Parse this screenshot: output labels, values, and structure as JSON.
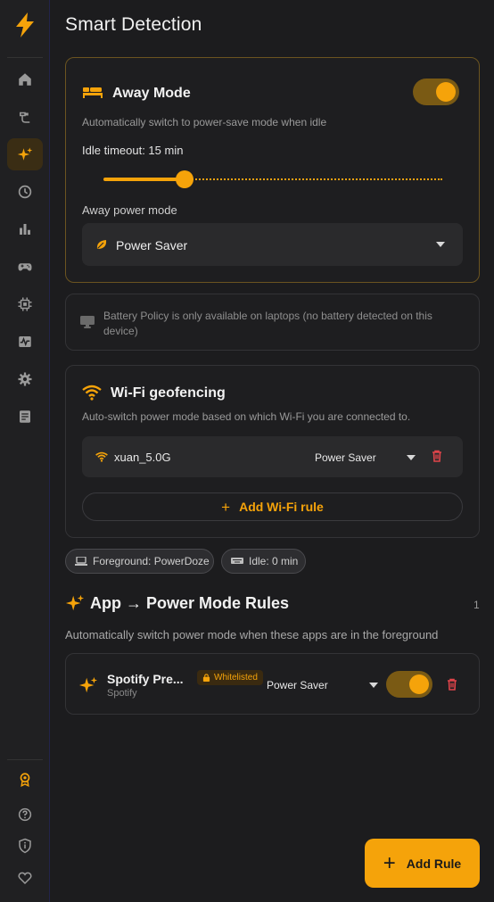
{
  "sidebar": {
    "logo_icon": "lightning-bolt-icon",
    "top_items": [
      {
        "icon": "home-icon"
      },
      {
        "icon": "plug-icon"
      },
      {
        "icon": "sparkles-icon",
        "active": true
      },
      {
        "icon": "clock-icon"
      },
      {
        "icon": "bar-chart-icon"
      },
      {
        "icon": "gamepad-icon"
      },
      {
        "icon": "cpu-icon"
      },
      {
        "icon": "activity-monitor-icon"
      },
      {
        "icon": "gear-icon"
      },
      {
        "icon": "document-icon"
      }
    ],
    "bottom_items": [
      {
        "icon": "award-icon"
      },
      {
        "icon": "help-icon"
      },
      {
        "icon": "shield-info-icon"
      },
      {
        "icon": "heart-icon"
      }
    ]
  },
  "page": {
    "title": "Smart Detection"
  },
  "away_mode": {
    "title": "Away Mode",
    "description": "Automatically switch to power-save mode when idle",
    "enabled": true,
    "idle_timeout_label": "Idle timeout: 15 min",
    "idle_timeout_fraction": 0.24,
    "power_mode_label": "Away power mode",
    "power_mode_value": "Power Saver"
  },
  "battery_notice": {
    "text": "Battery Policy is only available on laptops (no battery detected on this device)"
  },
  "wifi": {
    "title": "Wi-Fi geofencing",
    "description": "Auto-switch power mode based on which Wi-Fi you are connected to.",
    "rules": [
      {
        "ssid": "xuan_5.0G",
        "mode": "Power Saver"
      }
    ],
    "add_label": "Add Wi-Fi rule"
  },
  "status_chips": {
    "foreground": "Foreground: PowerDoze",
    "idle": "Idle: 0 min"
  },
  "app_rules": {
    "title": "App → Power Mode Rules",
    "count": "1",
    "description": "Automatically switch power mode when these apps are in the foreground",
    "rules": [
      {
        "name": "Spotify Pre...",
        "process": "Spotify",
        "badge": "Whitelisted",
        "mode": "Power Saver",
        "enabled": true
      }
    ]
  },
  "add_rule_button": {
    "label": "Add Rule"
  },
  "colors": {
    "accent": "#f5a30a",
    "delete": "#e0444a",
    "background": "#1c1c1e"
  }
}
